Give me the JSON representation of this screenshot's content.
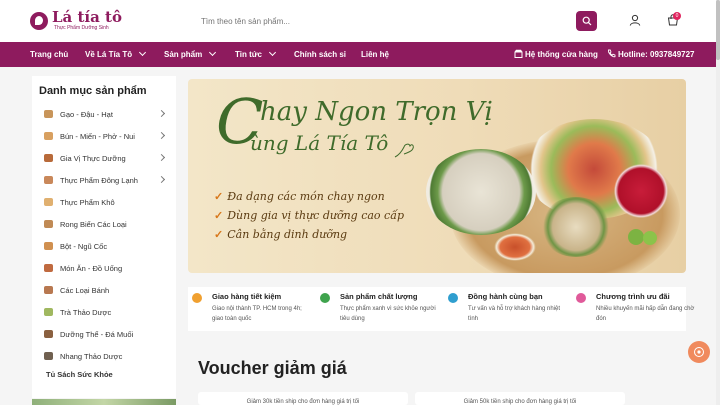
{
  "header": {
    "logo_name": "Lá tía tô",
    "logo_tagline": "Thực Phẩm Dưỡng Sinh",
    "search_placeholder": "Tìm theo tên sản phẩm...",
    "cart_count": "0"
  },
  "nav": {
    "items": [
      {
        "label": "Trang chủ"
      },
      {
        "label": "Về Lá Tía Tô"
      },
      {
        "label": "Sản phẩm"
      },
      {
        "label": "Tin tức"
      },
      {
        "label": "Chính sách sỉ"
      },
      {
        "label": "Liên hệ"
      }
    ],
    "stores_label": "Hệ thống cửa hàng",
    "hotline_label": "Hotline: 0937849727"
  },
  "sidebar": {
    "title": "Danh mục sản phẩm",
    "items": [
      {
        "label": "Gạo - Đậu - Hạt"
      },
      {
        "label": "Bún - Miến - Phở - Nui"
      },
      {
        "label": "Gia Vị Thực Dưỡng"
      },
      {
        "label": "Thực Phẩm Đông Lạnh"
      },
      {
        "label": "Thực Phẩm Khô"
      },
      {
        "label": "Rong Biển Các Loại"
      },
      {
        "label": "Bột - Ngũ Cốc"
      },
      {
        "label": "Món Ăn - Đồ Uống"
      },
      {
        "label": "Các Loại Bánh"
      },
      {
        "label": "Trà Thảo Dược"
      },
      {
        "label": "Dưỡng Thể - Đá Muối"
      },
      {
        "label": "Nhang Thảo Dược"
      }
    ],
    "extra_item": "Tủ Sách Sức Khỏe"
  },
  "hero": {
    "title_c": "C",
    "title_line1": "hay Ngon Trọn Vị",
    "title_line2": "ùng Lá Tía Tô",
    "bullets": [
      "Đa dạng các món chay ngon",
      "Dùng gia vị thực dưỡng cao cấp",
      "Cân bằng dinh dưỡng"
    ]
  },
  "features": [
    {
      "title": "Giao hàng tiết kiệm",
      "desc": "Giao nội thành TP. HCM trong 4h; giao toàn quốc",
      "color": "#f0a030"
    },
    {
      "title": "Sản phẩm chất lượng",
      "desc": "Thực phẩm xanh vì sức khỏe người tiêu dùng",
      "color": "#3fa34d"
    },
    {
      "title": "Đồng hành cùng bạn",
      "desc": "Tư vấn và hỗ trợ khách hàng nhiệt tình",
      "color": "#2f9ecf"
    },
    {
      "title": "Chương trình ưu đãi",
      "desc": "Nhiều khuyến mãi hấp dẫn đang chờ đón",
      "color": "#e05a9a"
    }
  ],
  "vouchers": {
    "title": "Voucher giảm giá",
    "items": [
      {
        "text": "Giảm 30k tiền ship cho đơn hàng giá trị tối"
      },
      {
        "text": "Giảm 50k tiền ship cho đơn hàng giá trị tối"
      }
    ]
  },
  "colors": {
    "brand": "#8e1b5e",
    "hero_green": "#3f6b2b",
    "float_button": "#f08a5d"
  }
}
